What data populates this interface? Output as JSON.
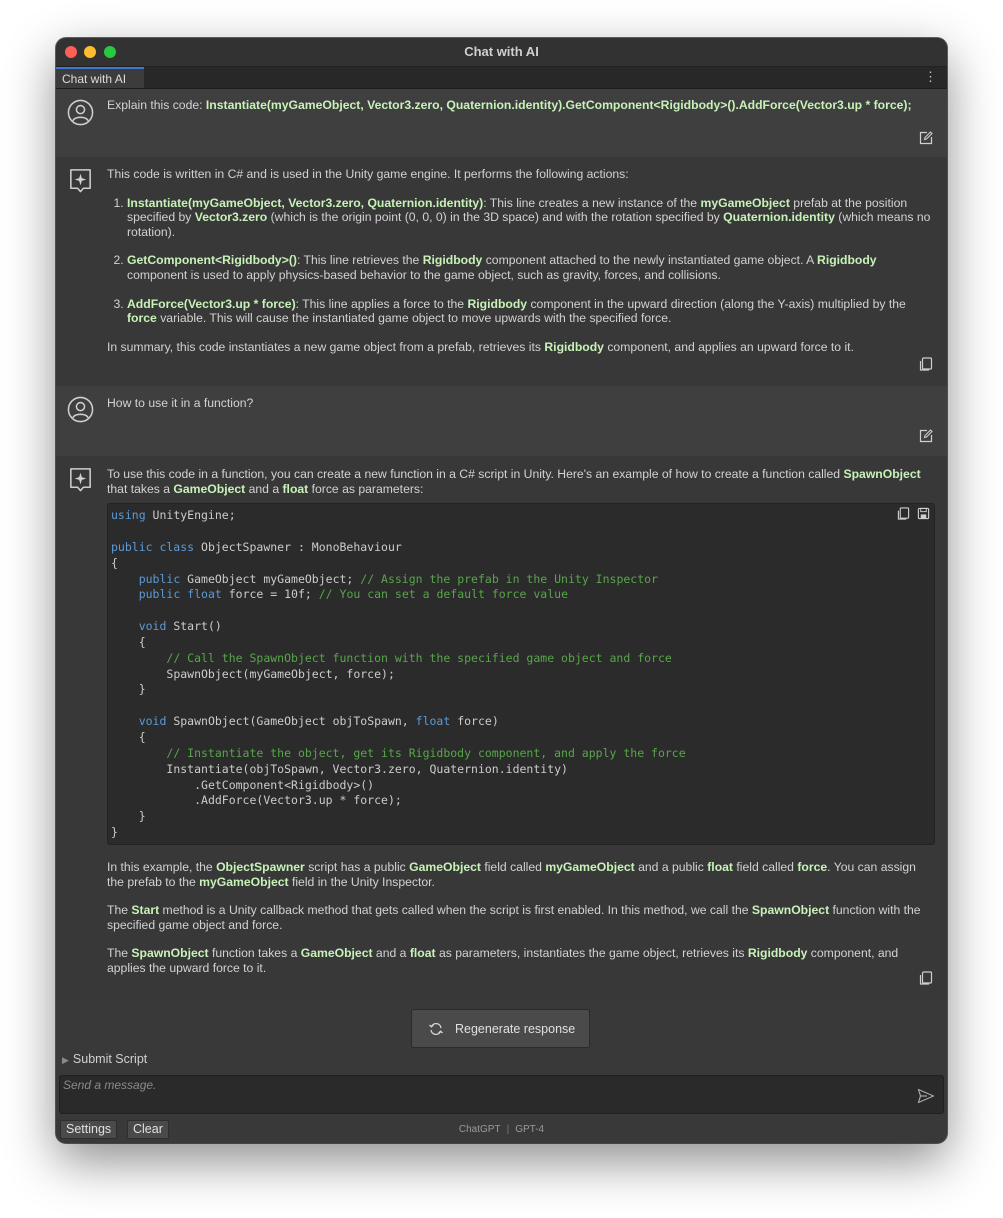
{
  "window": {
    "title": "Chat with AI"
  },
  "tabs": [
    {
      "label": "Chat with AI"
    }
  ],
  "messages": {
    "q1": {
      "prefix": "Explain this code: ",
      "code": "Instantiate(myGameObject, Vector3.zero, Quaternion.identity).GetComponent<Rigidbody>().AddForce(Vector3.up * force);"
    },
    "a1": {
      "intro": "This code is written in C# and is used in the Unity game engine. It performs the following actions:",
      "items": [
        {
          "h": "Instantiate(myGameObject, Vector3.zero, Quaternion.identity)",
          "t1": ": This line creates a new instance of the ",
          "b1": "myGameObject",
          "t2": " prefab at the position specified by ",
          "b2": "Vector3.zero",
          "t3": " (which is the origin point (0, 0, 0) in the 3D space) and with the rotation specified by ",
          "b3": "Quaternion.identity",
          "t4": " (which means no rotation)."
        },
        {
          "h": "GetComponent<Rigidbody>()",
          "t1": ": This line retrieves the ",
          "b1": "Rigidbody",
          "t2": " component attached to the newly instantiated game object. A ",
          "b2": "Rigidbody",
          "t3": " component is used to apply physics-based behavior to the game object, such as gravity, forces, and collisions."
        },
        {
          "h": "AddForce(Vector3.up * force)",
          "t1": ": This line applies a force to the ",
          "b1": "Rigidbody",
          "t2": " component in the upward direction (along the Y-axis) multiplied by the ",
          "b2": "force",
          "t3": " variable. This will cause the instantiated game object to move upwards with the specified force."
        }
      ],
      "summary": {
        "t1": "In summary, this code instantiates a new game object from a prefab, retrieves its ",
        "b1": "Rigidbody",
        "t2": " component, and applies an upward force to it."
      }
    },
    "q2": {
      "text": "How to use it in a function?"
    },
    "a2": {
      "intro": {
        "t1": "To use this code in a function, you can create a new function in a C# script in Unity. Here's an example of how to create a function called ",
        "b1": "SpawnObject",
        "t2": " that takes a ",
        "b2": "GameObject",
        "t3": " and a ",
        "b3": "float",
        "t4": " force as parameters:"
      },
      "code": {
        "l1_kw": "using",
        "l1_rest": " UnityEngine;",
        "l3_kw": "public class",
        "l3_rest": " ObjectSpawner : MonoBehaviour",
        "l4": "{",
        "l5_kw": "public",
        "l5_rest": " GameObject myGameObject; ",
        "l5_cm": "// Assign the prefab in the Unity Inspector",
        "l6_kw1": "public",
        "l6_kw2": "float",
        "l6_rest": " force = 10f; ",
        "l6_cm": "// You can set a default force value",
        "l8_kw": "void",
        "l8_rest": " Start()",
        "l9": "{",
        "l10_cm": "// Call the SpawnObject function with the specified game object and force",
        "l11": "SpawnObject(myGameObject, force);",
        "l12": "}",
        "l14_kw1": "void",
        "l14_mid": " SpawnObject(GameObject objToSpawn, ",
        "l14_kw2": "float",
        "l14_end": " force)",
        "l15": "{",
        "l16_cm": "// Instantiate the object, get its Rigidbody component, and apply the force",
        "l17": "Instantiate(objToSpawn, Vector3.zero, Quaternion.identity)",
        "l18": ".GetComponent<Rigidbody>()",
        "l19": ".AddForce(Vector3.up * force);",
        "l20": "}",
        "l21": "}"
      },
      "p1": {
        "t1": "In this example, the ",
        "b1": "ObjectSpawner",
        "t2": " script has a public ",
        "b2": "GameObject",
        "t3": " field called ",
        "b3": "myGameObject",
        "t4": " and a public ",
        "b4": "float",
        "t5": " field called ",
        "b5": "force",
        "t6": ". You can assign the prefab to the ",
        "b6": "myGameObject",
        "t7": " field in the Unity Inspector."
      },
      "p2": {
        "t1": "The ",
        "b1": "Start",
        "t2": " method is a Unity callback method that gets called when the script is first enabled. In this method, we call the ",
        "b2": "SpawnObject",
        "t3": " function with the specified game object and force."
      },
      "p3": {
        "t1": "The ",
        "b1": "SpawnObject",
        "t2": " function takes a ",
        "b2": "GameObject",
        "t3": " and a ",
        "b3": "float",
        "t4": " as parameters, instantiates the game object, retrieves its ",
        "b4": "Rigidbody",
        "t5": " component, and applies the upward force to it."
      }
    }
  },
  "regenerate_label": "Regenerate response",
  "submit_label": "Submit Script",
  "input": {
    "placeholder": "Send a message."
  },
  "footer": {
    "settings_label": "Settings",
    "clear_label": "Clear",
    "provider": "ChatGPT",
    "separator": "|",
    "model": "GPT-4"
  },
  "colors": {
    "highlight": "#c7f2b8",
    "keyword": "#5c9bd6",
    "comment": "#57a64a"
  }
}
